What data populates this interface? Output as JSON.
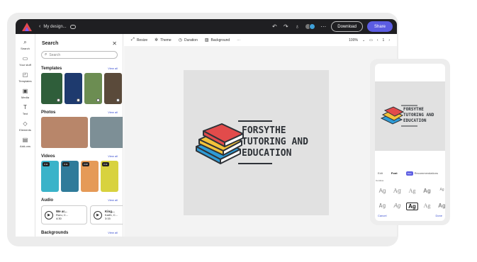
{
  "topbar": {
    "breadcrumb": "My design...",
    "download_label": "Download",
    "share_label": "Share",
    "more_icon": "ellipsis-icon",
    "accent": "#5b5ce2"
  },
  "rail": {
    "items": [
      {
        "label": "Search",
        "icon": "search-icon",
        "glyph": "⌕"
      },
      {
        "label": "Your stuff",
        "icon": "folder-icon",
        "glyph": "▭"
      },
      {
        "label": "Templates",
        "icon": "templates-icon",
        "glyph": "◰"
      },
      {
        "label": "Media",
        "icon": "media-icon",
        "glyph": "▣"
      },
      {
        "label": "Text",
        "icon": "text-icon",
        "glyph": "T"
      },
      {
        "label": "Elements",
        "icon": "elements-icon",
        "glyph": "◇"
      },
      {
        "label": "Add-ons",
        "icon": "addons-icon",
        "glyph": "▤"
      }
    ]
  },
  "panel": {
    "title": "Search",
    "search_placeholder": "Search",
    "view_all": "View all",
    "sections": {
      "templates": "Templates",
      "photos": "Photos",
      "videos": "Videos",
      "audio": "Audio",
      "backgrounds": "Backgrounds"
    },
    "video_badges": [
      "0:11",
      "0:11",
      "0:08",
      "0:11"
    ],
    "audio": [
      {
        "title": "We ar...",
        "artist": "Ruru, C...",
        "time": "4:30"
      },
      {
        "title": "King...",
        "artist": "Karth, C...",
        "time": "3:15"
      }
    ]
  },
  "canvas_toolbar": {
    "items": [
      "Resize",
      "Theme",
      "Duration",
      "Background"
    ],
    "zoom": "100%",
    "page": "1"
  },
  "design": {
    "line1": "FORSYTHE",
    "line2": "TUTORING AND",
    "line3": "EDUCATION",
    "book_colors": [
      "#e24b4b",
      "#f3c23a",
      "#2e9bd6"
    ]
  },
  "phone": {
    "tabs": [
      "Edit",
      "Font",
      "Recommendations"
    ],
    "badge": "New",
    "label": "Combos",
    "font_sample": "Ag",
    "cancel": "Cancel",
    "done": "Done"
  }
}
